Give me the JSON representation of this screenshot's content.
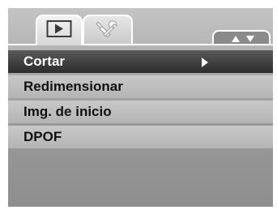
{
  "tabs": [
    {
      "icon": "playback-icon",
      "active": true
    },
    {
      "icon": "wrench-settings-icon",
      "active": false
    }
  ],
  "scroll": {
    "up_icon": "scroll-up-icon",
    "down_icon": "scroll-down-icon"
  },
  "menu": {
    "items": [
      {
        "label": "Cortar",
        "selected": true
      },
      {
        "label": "Redimensionar",
        "selected": false
      },
      {
        "label": "Img. de inicio",
        "selected": false
      },
      {
        "label": "DPOF",
        "selected": false
      }
    ]
  },
  "colors": {
    "selected_bg": "#3a3a3a",
    "item_bg": "#bdbdbd",
    "screen_bg": "#a0a0a0",
    "text": "#111111",
    "selected_text": "#ffffff"
  }
}
